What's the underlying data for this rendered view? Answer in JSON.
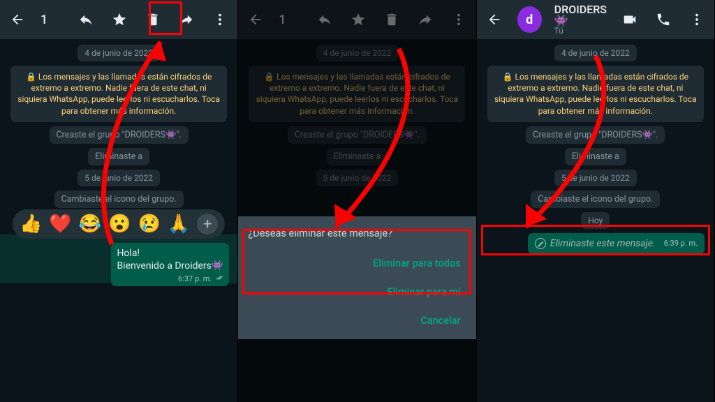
{
  "panel1": {
    "selection_count": "1",
    "date1": "4 de junio de 2022",
    "encrypt": "🔒 Los mensajes y las llamadas están cifrados de extremo a extremo. Nadie fuera de este chat, ni siquiera WhatsApp, puede leerlos ni escucharlos. Toca para obtener más información.",
    "sys_created": "Creaste el grupo \"DROIDERS👾\".",
    "sys_removed": "Eliminaste a ",
    "date2": "5 de junio de 2022",
    "sys_icon": "Cambiaste el icono del grupo.",
    "msg_line1": "Hola!",
    "msg_line2": "Bienvenido a Droiders👾",
    "msg_time": "6:37 p. m.",
    "reactions": [
      "👍",
      "❤️",
      "😂",
      "😮",
      "😢",
      "🙏"
    ]
  },
  "panel2": {
    "selection_count": "1",
    "date1": "4 de junio de 2022",
    "encrypt": "🔒 Los mensajes y las llamadas están cifrados de extremo a extremo. Nadie fuera de este chat, ni siquiera WhatsApp, puede leerlos ni escucharlos. Toca para obtener más información.",
    "sys_created": "Creaste el grupo \"DROIDERS👾\".",
    "sys_removed": "Eliminaste a ",
    "date2": "5 de junio de 2022",
    "dialog_q": "¿Deseas eliminar este mensaje?",
    "opt_all": "Eliminar para todos",
    "opt_me": "Eliminar para mí",
    "opt_cancel": "Cancelar"
  },
  "panel3": {
    "group_name": "DROIDERS👾",
    "subtitle": "Tú",
    "date1": "4 de junio de 2022",
    "encrypt": "🔒 Los mensajes y las llamadas están cifrados de extremo a extremo. Nadie fuera de este chat, ni siquiera WhatsApp, puede leerlos ni escucharlos. Toca para obtener más información.",
    "sys_created": "Creaste el grupo \"DROIDERS👾\".",
    "sys_removed": "Eliminaste a ",
    "date2": "5 de junio de 2022",
    "sys_icon": "Cambiaste el icono del grupo.",
    "today": "Hoy",
    "deleted_text": "Eliminaste este mensaje.",
    "deleted_time": "6:39 p. m."
  }
}
